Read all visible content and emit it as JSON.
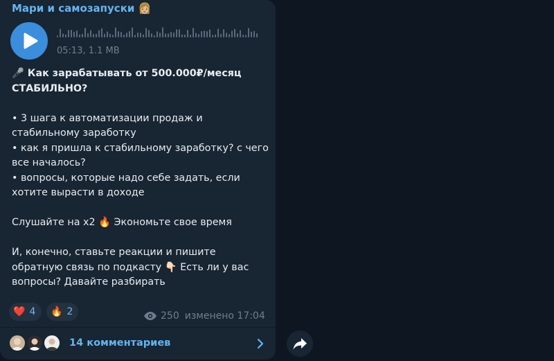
{
  "channel": {
    "name": "Мари и самозапуски 👩🏼"
  },
  "audio": {
    "meta": "05:13, 1.1 MB"
  },
  "post": {
    "lines": [
      "🎤 Как зарабатывать от 500.000₽/месяц",
      "СТАБИЛЬНО?",
      "",
      "• 3 шага к автоматизации продаж и",
      "стабильному заработку",
      "• как я пришла к стабильному заработку? с чего",
      "все началось?",
      "• вопросы, которые надо себе задать, если",
      "хотите вырасти в доходе",
      "",
      "Слушайте на х2 🔥 Экономьте свое время",
      "",
      "И, конечно, ставьте реакции и пишите",
      "обратную связь по подкасту 👇🏻 Есть ли у вас",
      "вопросы? Давайте разбирать"
    ]
  },
  "reactions": [
    {
      "emoji": "❤️",
      "count": "4"
    },
    {
      "emoji": "🔥",
      "count": "2"
    }
  ],
  "stats": {
    "views": "250",
    "edited": "изменено 17:04"
  },
  "comments": {
    "label": "14 комментариев"
  },
  "colors": {
    "accent": "#64b5ef",
    "bubble": "#182533",
    "background": "#0e1621",
    "play": "#3a8edb"
  }
}
